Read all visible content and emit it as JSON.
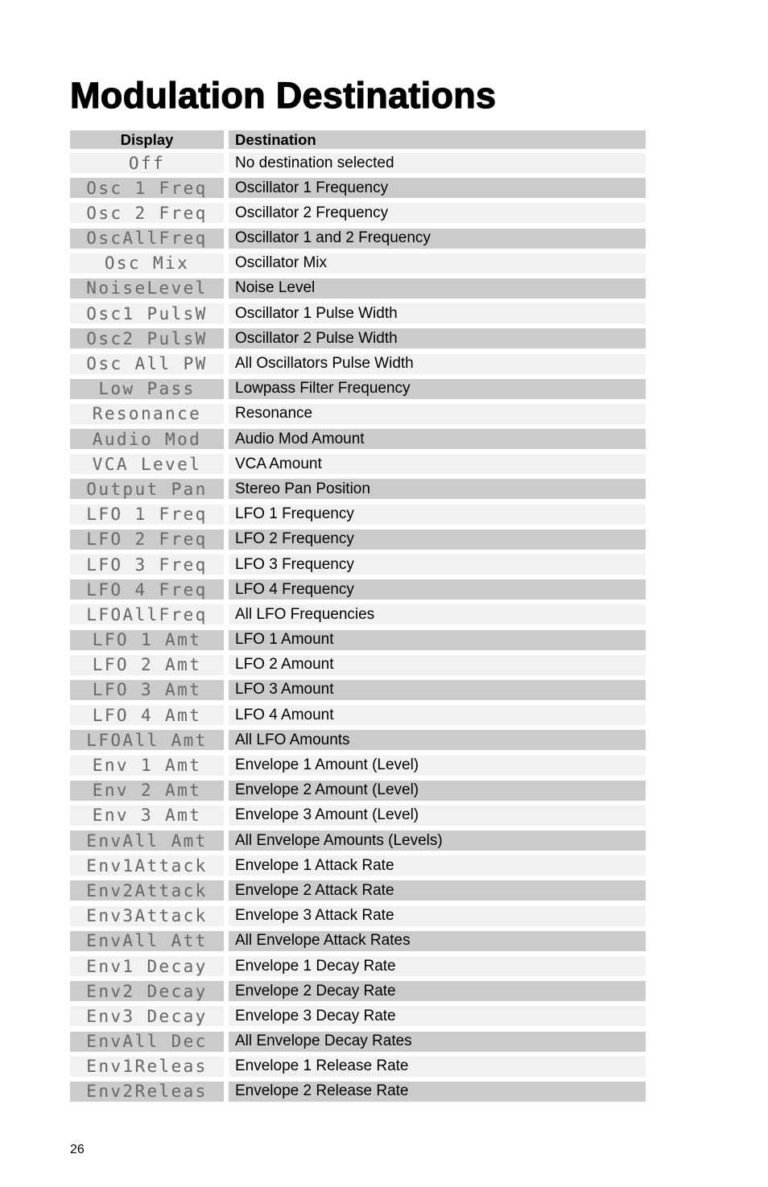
{
  "page": {
    "title": "Modulation Destinations",
    "page_number": "26"
  },
  "table": {
    "headers": {
      "display": "Display",
      "destination": "Destination"
    },
    "rows": [
      {
        "display": "Off",
        "destination": "No destination selected"
      },
      {
        "display": "Osc 1 Freq",
        "destination": "Oscillator 1 Frequency"
      },
      {
        "display": "Osc 2 Freq",
        "destination": "Oscillator 2 Frequency"
      },
      {
        "display": "OscAllFreq",
        "destination": "Oscillator 1 and 2 Frequency"
      },
      {
        "display": "Osc Mix",
        "destination": "Oscillator Mix"
      },
      {
        "display": "NoiseLevel",
        "destination": "Noise Level"
      },
      {
        "display": "Osc1 PulsW",
        "destination": "Oscillator 1 Pulse Width"
      },
      {
        "display": "Osc2 PulsW",
        "destination": "Oscillator 2 Pulse Width"
      },
      {
        "display": "Osc All PW",
        "destination": "All Oscillators Pulse Width"
      },
      {
        "display": "Low Pass",
        "destination": "Lowpass Filter Frequency"
      },
      {
        "display": "Resonance",
        "destination": "Resonance"
      },
      {
        "display": "Audio Mod",
        "destination": "Audio Mod Amount"
      },
      {
        "display": "VCA Level",
        "destination": "VCA Amount"
      },
      {
        "display": "Output Pan",
        "destination": "Stereo Pan Position"
      },
      {
        "display": "LFO 1 Freq",
        "destination": "LFO 1 Frequency"
      },
      {
        "display": "LFO 2 Freq",
        "destination": "LFO 2 Frequency"
      },
      {
        "display": "LFO 3 Freq",
        "destination": "LFO 3 Frequency"
      },
      {
        "display": "LFO 4 Freq",
        "destination": "LFO 4 Frequency"
      },
      {
        "display": "LFOAllFreq",
        "destination": "All LFO Frequencies"
      },
      {
        "display": "LFO 1 Amt",
        "destination": "LFO 1 Amount"
      },
      {
        "display": "LFO 2 Amt",
        "destination": "LFO 2 Amount"
      },
      {
        "display": "LFO 3 Amt",
        "destination": "LFO 3 Amount"
      },
      {
        "display": "LFO 4 Amt",
        "destination": "LFO 4 Amount"
      },
      {
        "display": "LFOAll Amt",
        "destination": "All LFO Amounts"
      },
      {
        "display": "Env 1 Amt",
        "destination": "Envelope 1 Amount (Level)"
      },
      {
        "display": "Env 2 Amt",
        "destination": "Envelope 2 Amount (Level)"
      },
      {
        "display": "Env 3 Amt",
        "destination": "Envelope 3 Amount (Level)"
      },
      {
        "display": "EnvAll Amt",
        "destination": "All Envelope Amounts (Levels)"
      },
      {
        "display": "Env1Attack",
        "destination": "Envelope 1 Attack Rate"
      },
      {
        "display": "Env2Attack",
        "destination": "Envelope 2 Attack Rate"
      },
      {
        "display": "Env3Attack",
        "destination": "Envelope 3 Attack Rate"
      },
      {
        "display": "EnvAll Att",
        "destination": "All Envelope Attack Rates"
      },
      {
        "display": "Env1 Decay",
        "destination": "Envelope 1 Decay Rate"
      },
      {
        "display": "Env2 Decay",
        "destination": "Envelope 2 Decay Rate"
      },
      {
        "display": "Env3 Decay",
        "destination": "Envelope 3 Decay Rate"
      },
      {
        "display": "EnvAll Dec",
        "destination": "All Envelope Decay Rates"
      },
      {
        "display": "Env1Releas",
        "destination": "Envelope 1 Release Rate"
      },
      {
        "display": "Env2Releas",
        "destination": "Envelope 2 Release Rate"
      }
    ]
  }
}
